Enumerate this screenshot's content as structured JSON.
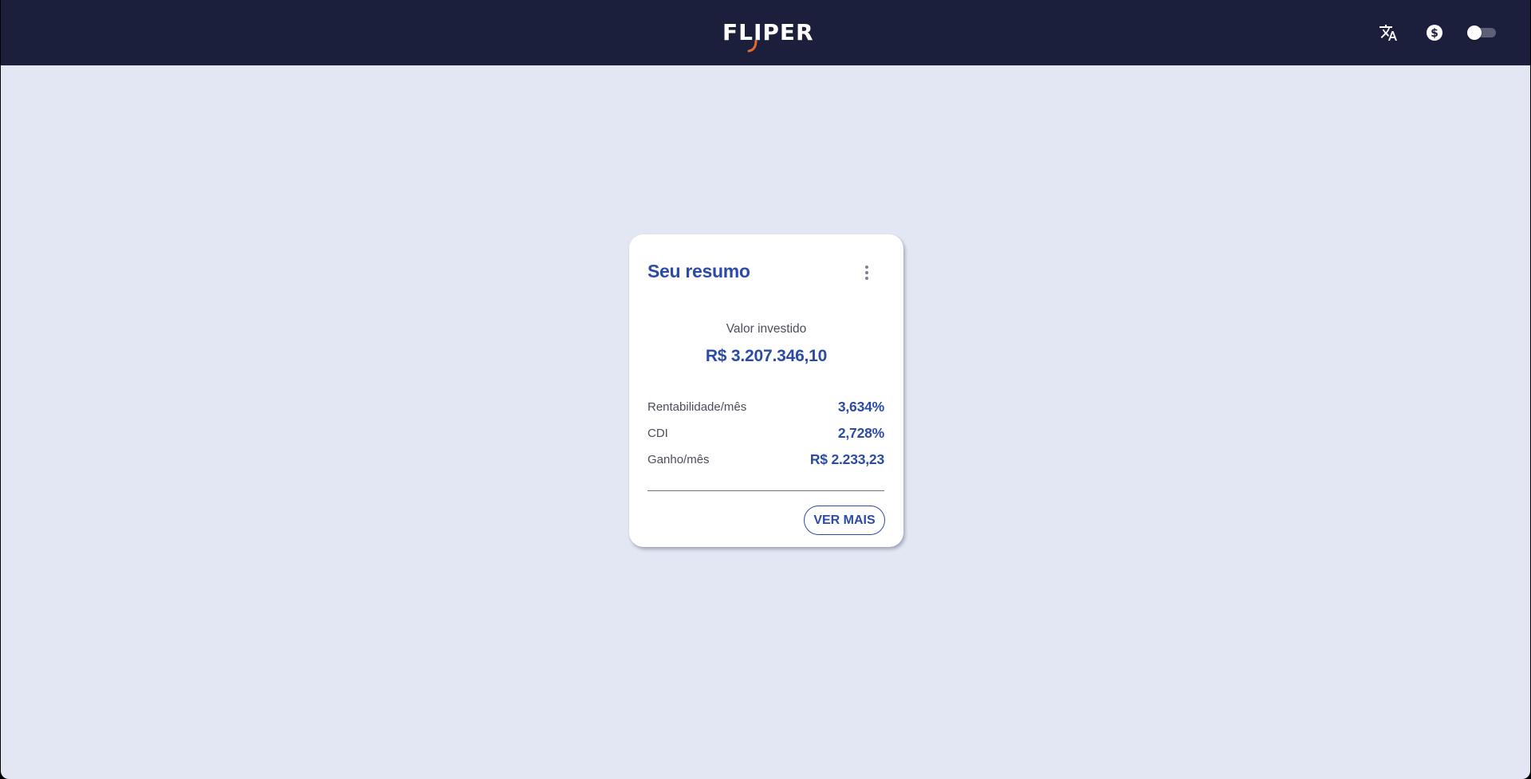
{
  "header": {
    "logo_text": "FLIPER",
    "icons": [
      "translate-icon",
      "currency-icon"
    ],
    "theme_toggle": {
      "state": "off"
    }
  },
  "card": {
    "title": "Seu resumo",
    "invested_label": "Valor investido",
    "invested_value": "R$ 3.207.346,10",
    "stats": [
      {
        "label": "Rentabilidade/mês",
        "value": "3,634%"
      },
      {
        "label": "CDI",
        "value": "2,728%"
      },
      {
        "label": "Ganho/mês",
        "value": "R$ 2.233,23"
      }
    ],
    "button_label": "VER MAIS"
  },
  "colors": {
    "header_bg": "#1c1f3b",
    "page_bg": "#e3e7f3",
    "accent_blue": "#2b4ba6",
    "logo_accent": "#e8692c"
  }
}
